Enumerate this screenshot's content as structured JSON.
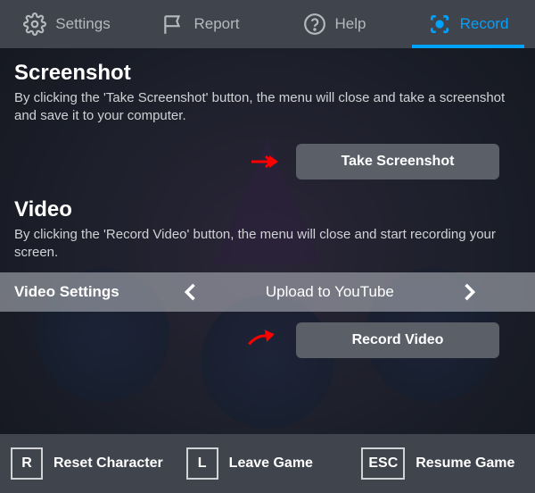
{
  "tabs": {
    "settings": "Settings",
    "report": "Report",
    "help": "Help",
    "record": "Record"
  },
  "screenshot": {
    "title": "Screenshot",
    "desc": "By clicking the 'Take Screenshot' button, the menu will close and take a screenshot and save it to your computer.",
    "button": "Take Screenshot"
  },
  "video": {
    "title": "Video",
    "desc": "By clicking the 'Record Video' button, the menu will close and start recording your screen.",
    "settings_label": "Video Settings",
    "settings_value": "Upload to YouTube",
    "button": "Record Video"
  },
  "footer": {
    "reset": {
      "key": "R",
      "label": "Reset Character"
    },
    "leave": {
      "key": "L",
      "label": "Leave Game"
    },
    "resume": {
      "key": "ESC",
      "label": "Resume Game"
    }
  }
}
